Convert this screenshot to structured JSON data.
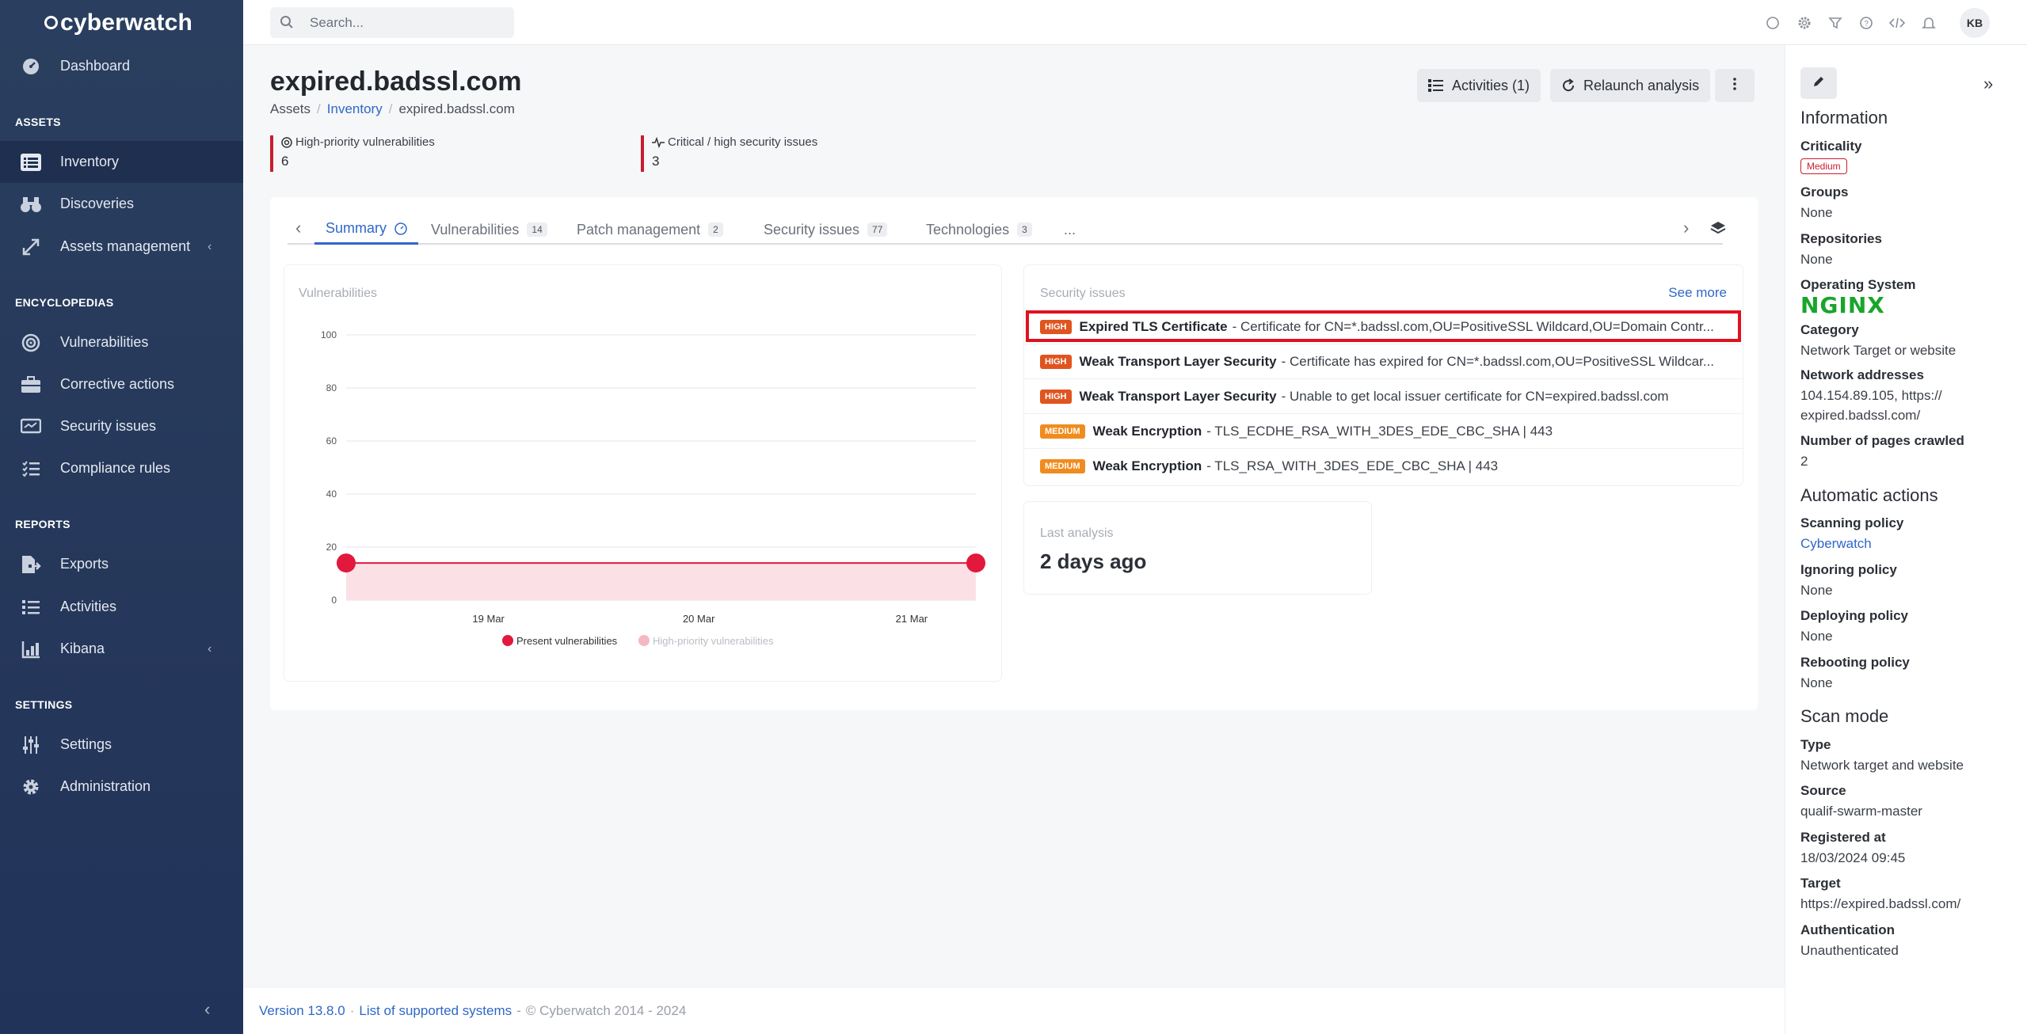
{
  "brand": "cyberwatch",
  "sidebar": {
    "sections": {
      "assets": "ASSETS",
      "encyclopedias": "ENCYCLOPEDIAS",
      "reports": "REPORTS",
      "settings": "SETTINGS"
    },
    "items": {
      "dashboard": "Dashboard",
      "inventory": "Inventory",
      "discoveries": "Discoveries",
      "assets_management": "Assets management",
      "vulnerabilities": "Vulnerabilities",
      "corrective_actions": "Corrective actions",
      "security_issues": "Security issues",
      "compliance_rules": "Compliance rules",
      "exports": "Exports",
      "activities": "Activities",
      "kibana": "Kibana",
      "settings": "Settings",
      "administration": "Administration"
    }
  },
  "topbar": {
    "search_placeholder": "Search...",
    "avatar": "KB"
  },
  "page": {
    "title": "expired.badssl.com",
    "breadcrumb": [
      "Assets",
      "Inventory",
      "expired.badssl.com"
    ],
    "buttons": {
      "activities": "Activities (1)",
      "relaunch": "Relaunch analysis"
    },
    "kpis": [
      {
        "label": "High-priority vulnerabilities",
        "value": "6"
      },
      {
        "label": "Critical / high security issues",
        "value": "3"
      }
    ]
  },
  "tabs": [
    {
      "label": "Summary",
      "badge": ""
    },
    {
      "label": "Vulnerabilities",
      "badge": "14"
    },
    {
      "label": "Patch management",
      "badge": "2"
    },
    {
      "label": "Security issues",
      "badge": "77"
    },
    {
      "label": "Technologies",
      "badge": "3"
    },
    {
      "label": "...",
      "badge": ""
    }
  ],
  "vuln_card": {
    "title": "Vulnerabilities"
  },
  "chart_data": {
    "type": "area",
    "title": "Vulnerabilities",
    "x": [
      "19 Mar",
      "20 Mar",
      "21 Mar"
    ],
    "y_ticks": [
      0,
      20,
      40,
      60,
      80,
      100
    ],
    "ylim": [
      0,
      100
    ],
    "series": [
      {
        "name": "Present vulnerabilities",
        "start": 14,
        "end": 14,
        "color": "#e2183c"
      },
      {
        "name": "High-priority vulnerabilities",
        "start": null,
        "end": null,
        "color": "#f4b8c2"
      }
    ],
    "legend": "bottom"
  },
  "security_card": {
    "title": "Security issues",
    "see_more": "See more",
    "rows": [
      {
        "severity": "HIGH",
        "name": "Expired TLS Certificate",
        "desc": "- Certificate for CN=*.badssl.com,OU=PositiveSSL Wildcard,OU=Domain Contr..."
      },
      {
        "severity": "HIGH",
        "name": "Weak Transport Layer Security",
        "desc": "- Certificate has expired for CN=*.badssl.com,OU=PositiveSSL Wildcar..."
      },
      {
        "severity": "HIGH",
        "name": "Weak Transport Layer Security",
        "desc": "- Unable to get local issuer certificate for CN=expired.badssl.com"
      },
      {
        "severity": "MEDIUM",
        "name": "Weak Encryption",
        "desc": "- TLS_ECDHE_RSA_WITH_3DES_EDE_CBC_SHA | 443"
      },
      {
        "severity": "MEDIUM",
        "name": "Weak Encryption",
        "desc": "- TLS_RSA_WITH_3DES_EDE_CBC_SHA | 443"
      }
    ]
  },
  "last_analysis": {
    "label": "Last analysis",
    "value": "2 days ago"
  },
  "footer": {
    "version": "Version 13.8.0",
    "list": "List of supported systems",
    "copy": "© Cyberwatch 2014 - 2024"
  },
  "right_panel": {
    "information": "Information",
    "criticality_label": "Criticality",
    "criticality": "Medium",
    "groups_label": "Groups",
    "groups": "None",
    "repositories_label": "Repositories",
    "repositories": "None",
    "os_label": "Operating System",
    "os": "NGINX",
    "category_label": "Category",
    "category": "Network Target or website",
    "addresses_label": "Network addresses",
    "addresses": "104.154.89.105, https://\nexpired.badssl.com/",
    "pages_label": "Number of pages crawled",
    "pages": "2",
    "automatic": "Automatic actions",
    "scanning_label": "Scanning policy",
    "scanning": "Cyberwatch",
    "ignoring_label": "Ignoring policy",
    "ignoring": "None",
    "deploying_label": "Deploying policy",
    "deploying": "None",
    "rebooting_label": "Rebooting policy",
    "rebooting": "None",
    "scan_mode": "Scan mode",
    "type_label": "Type",
    "type": "Network target and website",
    "source_label": "Source",
    "source": "qualif-swarm-master",
    "registered_label": "Registered at",
    "registered": "18/03/2024 09:45",
    "target_label": "Target",
    "target": "https://expired.badssl.com/",
    "auth_label": "Authentication",
    "auth": "Unauthenticated"
  }
}
